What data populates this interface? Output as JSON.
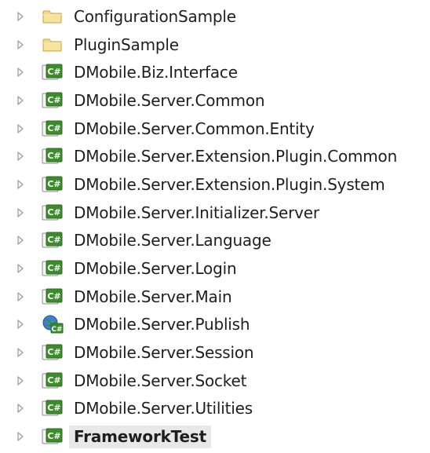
{
  "tree": {
    "items": [
      {
        "label": "ConfigurationSample",
        "icon": "folder-icon",
        "selected": false
      },
      {
        "label": "PluginSample",
        "icon": "folder-icon",
        "selected": false
      },
      {
        "label": "DMobile.Biz.Interface",
        "icon": "csharp-project-icon",
        "selected": false
      },
      {
        "label": "DMobile.Server.Common",
        "icon": "csharp-project-icon",
        "selected": false
      },
      {
        "label": "DMobile.Server.Common.Entity",
        "icon": "csharp-project-icon",
        "selected": false
      },
      {
        "label": "DMobile.Server.Extension.Plugin.Common",
        "icon": "csharp-project-icon",
        "selected": false
      },
      {
        "label": "DMobile.Server.Extension.Plugin.System",
        "icon": "csharp-project-icon",
        "selected": false
      },
      {
        "label": "DMobile.Server.Initializer.Server",
        "icon": "csharp-project-icon",
        "selected": false
      },
      {
        "label": "DMobile.Server.Language",
        "icon": "csharp-project-icon",
        "selected": false
      },
      {
        "label": "DMobile.Server.Login",
        "icon": "csharp-project-icon",
        "selected": false
      },
      {
        "label": "DMobile.Server.Main",
        "icon": "csharp-project-icon",
        "selected": false
      },
      {
        "label": "DMobile.Server.Publish",
        "icon": "csharp-web-project-icon",
        "selected": false
      },
      {
        "label": "DMobile.Server.Session",
        "icon": "csharp-project-icon",
        "selected": false
      },
      {
        "label": "DMobile.Server.Socket",
        "icon": "csharp-project-icon",
        "selected": false
      },
      {
        "label": "DMobile.Server.Utilities",
        "icon": "csharp-project-icon",
        "selected": false
      },
      {
        "label": "FrameworkTest",
        "icon": "csharp-project-icon",
        "selected": true
      }
    ]
  },
  "colors": {
    "expander": "#9a9a9a",
    "folder_fill": "#f2d88a",
    "folder_edge": "#c9a64a",
    "project_green": "#3c8c2c",
    "project_border": "#2f6b23",
    "selection_bg": "#e8e8e8"
  }
}
